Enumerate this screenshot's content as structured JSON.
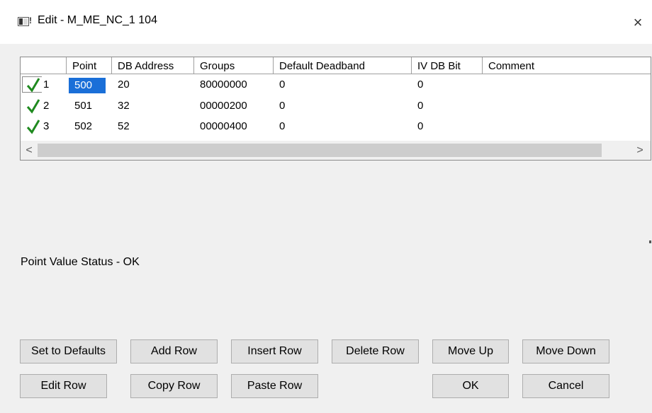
{
  "window": {
    "title": "Edit - M_ME_NC_1 104",
    "close_glyph": "×"
  },
  "grid": {
    "columns": [
      "Point",
      "DB Address",
      "Groups",
      "Default Deadband",
      "IV DB Bit",
      "Comment"
    ],
    "rows": [
      {
        "num": "1",
        "status_icon": "check-icon",
        "point": "500",
        "db_address": "20",
        "groups": "80000000",
        "default_deadband": "0",
        "iv_db_bit": "0",
        "comment": ""
      },
      {
        "num": "2",
        "status_icon": "check-icon",
        "point": "501",
        "db_address": "32",
        "groups": "00000200",
        "default_deadband": "0",
        "iv_db_bit": "0",
        "comment": ""
      },
      {
        "num": "3",
        "status_icon": "check-icon",
        "point": "502",
        "db_address": "52",
        "groups": "00000400",
        "default_deadband": "0",
        "iv_db_bit": "0",
        "comment": ""
      }
    ],
    "selected_cell": {
      "row": 0,
      "column": "Point"
    },
    "scroll_left_glyph": "<",
    "scroll_right_glyph": ">",
    "check_color": "#1f8a1f"
  },
  "status": {
    "text": "Point Value Status - OK"
  },
  "buttons": {
    "set_defaults": "Set to Defaults",
    "add_row": "Add Row",
    "insert_row": "Insert Row",
    "delete_row": "Delete Row",
    "move_up": "Move Up",
    "move_down": "Move Down",
    "edit_row": "Edit Row",
    "copy_row": "Copy Row",
    "paste_row": "Paste Row",
    "ok": "OK",
    "cancel": "Cancel"
  },
  "colors": {
    "selection": "#1a6fd8",
    "button_face": "#e1e1e1",
    "dialog_bg": "#f0f0f0"
  }
}
